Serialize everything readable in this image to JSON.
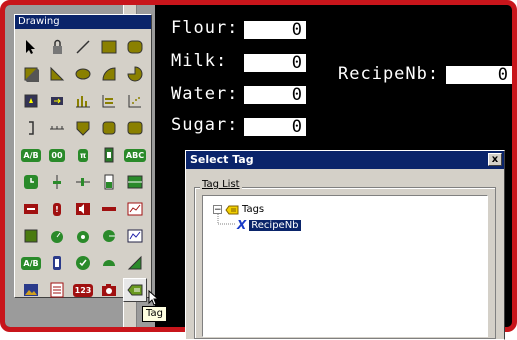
{
  "toolbar": {
    "title": "Drawing",
    "tools": [
      {
        "icon": "pointer-icon"
      },
      {
        "icon": "lock-icon"
      },
      {
        "icon": "line-icon"
      },
      {
        "icon": "rectangle-icon"
      },
      {
        "icon": "rounded-rectangle-icon"
      },
      {
        "icon": "3d-rectangle-icon"
      },
      {
        "icon": "polygon-icon"
      },
      {
        "icon": "ellipse-icon"
      },
      {
        "icon": "arc-icon"
      },
      {
        "icon": "pie-icon"
      },
      {
        "icon": "push-button-icon"
      },
      {
        "icon": "bitmap-button-icon"
      },
      {
        "icon": "bar-chart-icon"
      },
      {
        "icon": "trend-icon"
      },
      {
        "icon": "scatter-chart-icon"
      },
      {
        "icon": "bracket-icon"
      },
      {
        "icon": "scale-icon"
      },
      {
        "icon": "shield-icon"
      },
      {
        "icon": "square-button-icon"
      },
      {
        "icon": "abc-button-icon"
      },
      {
        "text": "A/B"
      },
      {
        "text": "00"
      },
      {
        "text": "π"
      },
      {
        "icon": "level-icon"
      },
      {
        "text": "ABC"
      },
      {
        "icon": "clock-icon"
      },
      {
        "icon": "slider-icon"
      },
      {
        "icon": "horizontal-slider-icon"
      },
      {
        "icon": "tank-icon"
      },
      {
        "icon": "grid-icon"
      },
      {
        "icon": "alarm-icon"
      },
      {
        "text": "!"
      },
      {
        "icon": "speaker-icon"
      },
      {
        "icon": "progress-icon"
      },
      {
        "icon": "chart-window-icon"
      },
      {
        "icon": "square-icon"
      },
      {
        "icon": "gauge-icon"
      },
      {
        "icon": "meter-icon"
      },
      {
        "icon": "radial-icon"
      },
      {
        "icon": "line-chart-icon"
      },
      {
        "text": "A/B"
      },
      {
        "icon": "battery-icon"
      },
      {
        "icon": "check-circle-icon"
      },
      {
        "icon": "dial-icon"
      },
      {
        "icon": "triangle-gauge-icon"
      },
      {
        "icon": "image-icon"
      },
      {
        "icon": "document-icon"
      },
      {
        "text": "123"
      },
      {
        "icon": "camera-icon"
      },
      {
        "icon": "tag-icon",
        "selected": true
      }
    ]
  },
  "tooltip": "Tag",
  "fields": [
    {
      "label": "Flour:",
      "value": "0"
    },
    {
      "label": "Milk:",
      "value": "0"
    },
    {
      "label": "Water:",
      "value": "0"
    },
    {
      "label": "Sugar:",
      "value": "0"
    },
    {
      "label": "RecipeNb:",
      "value": "0"
    }
  ],
  "dialog": {
    "title": "Select Tag",
    "close": "x",
    "group_label": "Tag List",
    "root": {
      "expander": "−",
      "label": "Tags"
    },
    "child": {
      "label": "RecipeNb"
    }
  },
  "colors": {
    "accent": "#c8151b",
    "titlebar": "#0a246a",
    "tool_fill": "#8a8000"
  }
}
